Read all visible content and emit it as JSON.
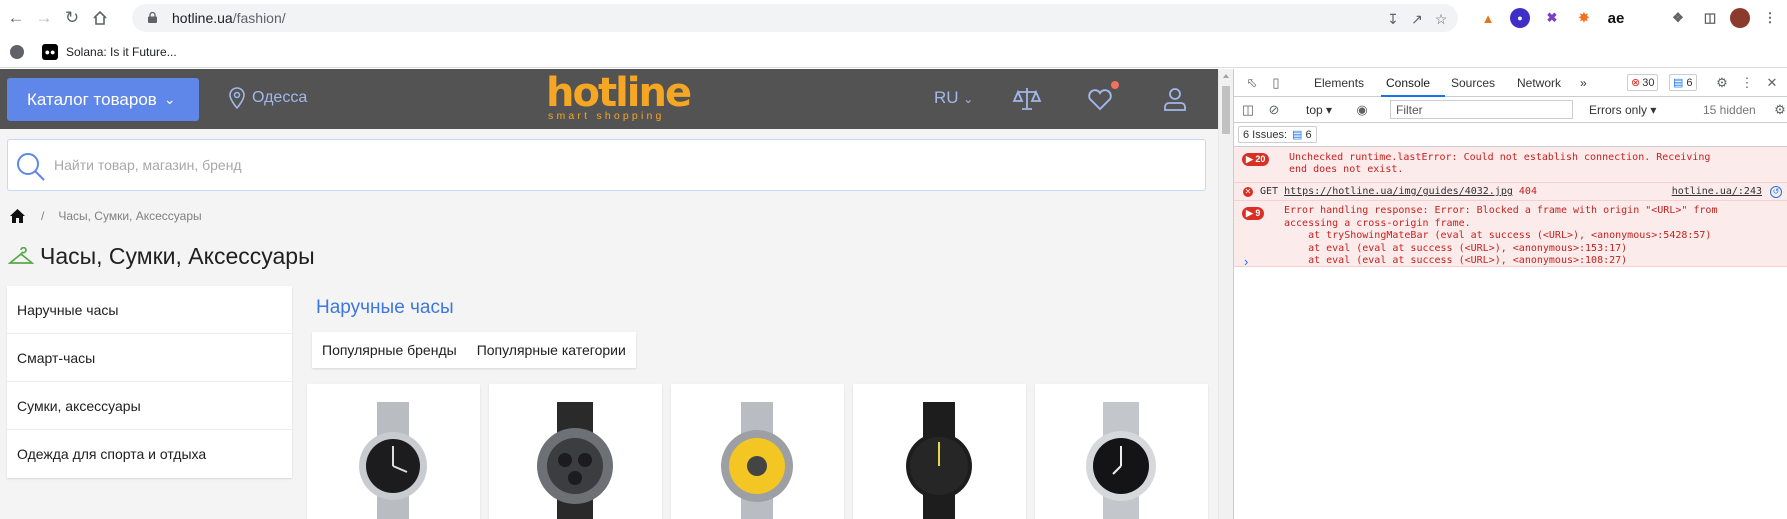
{
  "browser": {
    "url_host": "hotline.ua",
    "url_path": "/fashion/",
    "bookmark_label": "Solana: Is it Future...",
    "extensions": [
      "metamask-icon",
      "ext-circle-icon",
      "ext-x-icon",
      "ext-star-icon",
      "ae"
    ]
  },
  "site": {
    "catalog_label": "Каталог товаров",
    "city": "Одесса",
    "logo_word": "hotline",
    "logo_tagline": "smart shopping",
    "lang": "RU",
    "search_placeholder": "Найти товар, магазин, бренд",
    "breadcrumb": "Часы, Сумки, Аксессуары",
    "page_title": "Часы, Сумки, Аксессуары",
    "sidebar": [
      "Наручные часы",
      "Смарт-часы",
      "Сумки, аксессуары",
      "Одежда для спорта и отдыха"
    ],
    "section_title": "Наручные часы",
    "tabs": [
      "Популярные бренды",
      "Популярные категории"
    ],
    "product_count": 5
  },
  "devtools": {
    "tabs": [
      "Elements",
      "Console",
      "Sources",
      "Network"
    ],
    "active_tab": "Console",
    "error_count": "30",
    "issue_count": "6",
    "context": "top",
    "filter_placeholder": "Filter",
    "levels": "Errors only",
    "hidden": "15 hidden",
    "issues_label": "6 Issues:",
    "issues_num": "6",
    "messages": [
      {
        "count": "20",
        "line1": "Unchecked runtime.lastError: Could not establish connection. Receiving",
        "line2": "end does not exist."
      },
      {
        "get_prefix": "GET",
        "url": "https://hotline.ua/img/guides/4032.jpg",
        "status": "404",
        "source": "hotline.ua/:243"
      },
      {
        "count": "9",
        "lines": "Error handling response: Error: Blocked a frame with origin \"<URL>\" from\naccessing a cross-origin frame.\n    at tryShowingMateBar (eval at success (<URL>), <anonymous>:5428:57)\n    at eval (eval at success (<URL>), <anonymous>:153:17)\n    at eval (eval at success (<URL>), <anonymous>:108:27)"
      }
    ]
  }
}
